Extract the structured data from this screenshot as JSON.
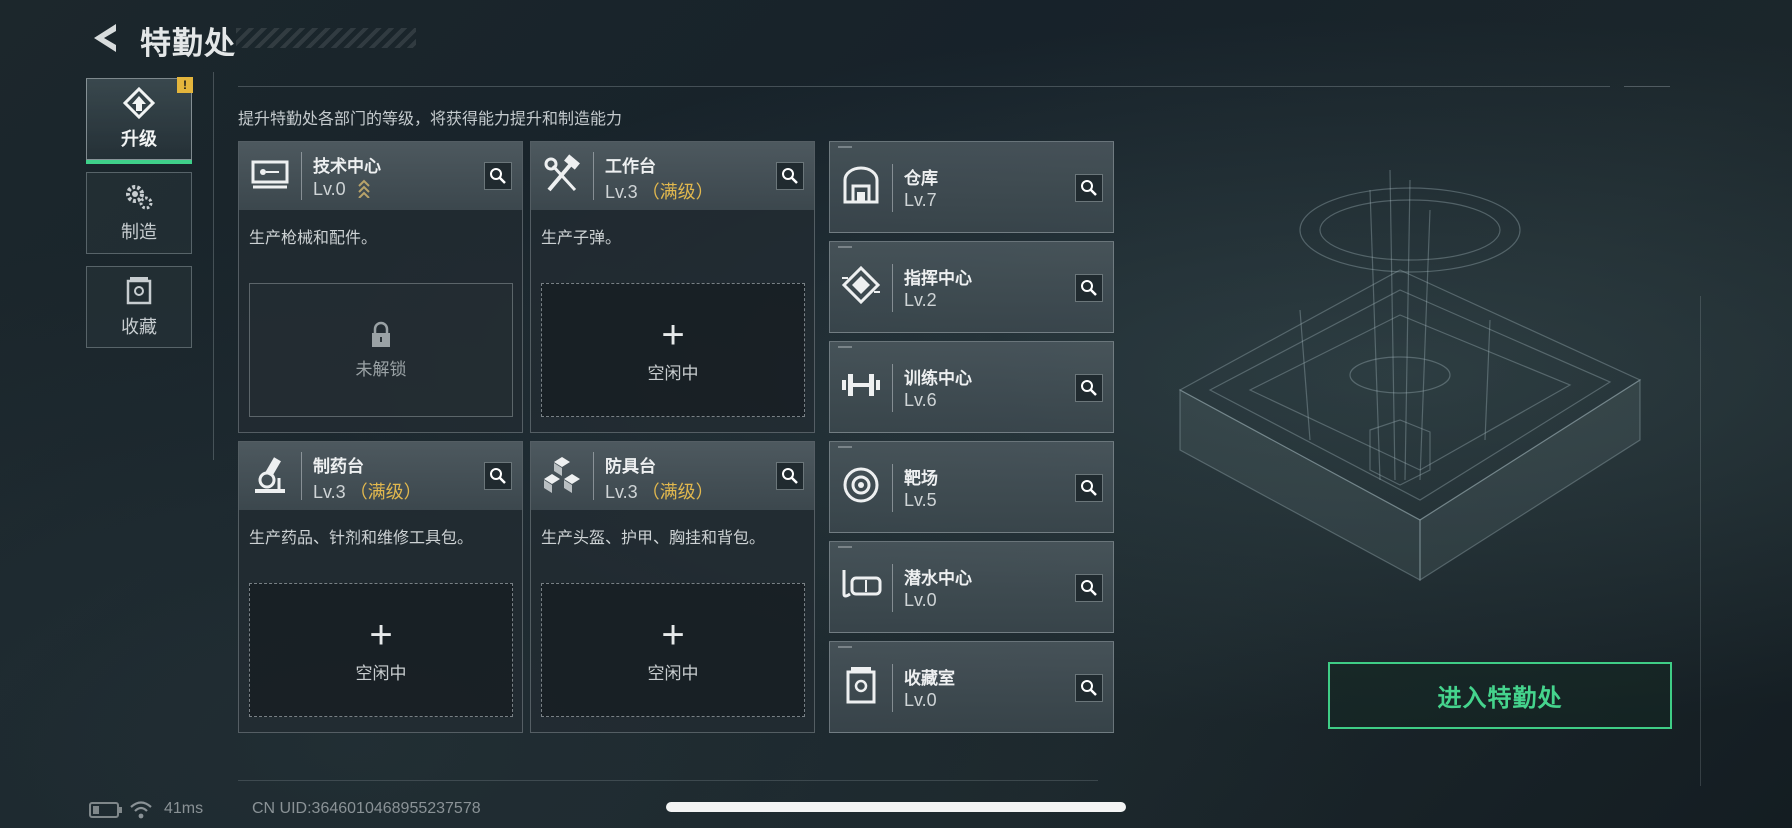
{
  "header": {
    "title": "特勤处"
  },
  "tabs": [
    {
      "label": "升级",
      "active": true,
      "badge": "!",
      "icon": "upgrade-icon"
    },
    {
      "label": "制造",
      "active": false,
      "icon": "gears-icon"
    },
    {
      "label": "收藏",
      "active": false,
      "icon": "collection-icon"
    }
  ],
  "subtitle": "提升特勤处各部门的等级，将获得能力提升和制造能力",
  "workbenches": [
    {
      "name": "技术中心",
      "level": "Lv.0",
      "maxed": "",
      "desc": "生产枪械和配件。",
      "slot": "未解锁",
      "locked": true,
      "icon": "tech-center-icon"
    },
    {
      "name": "工作台",
      "level": "Lv.3",
      "maxed": "（满级）",
      "desc": "生产子弹。",
      "slot": "空闲中",
      "locked": false,
      "icon": "workbench-tools-icon"
    },
    {
      "name": "制药台",
      "level": "Lv.3",
      "maxed": "（满级）",
      "desc": "生产药品、针剂和维修工具包。",
      "slot": "空闲中",
      "locked": false,
      "icon": "microscope-icon"
    },
    {
      "name": "防具台",
      "level": "Lv.3",
      "maxed": "（满级）",
      "desc": "生产头盔、护甲、胸挂和背包。",
      "slot": "空闲中",
      "locked": false,
      "icon": "armor-cubes-icon"
    }
  ],
  "facilities": [
    {
      "name": "仓库",
      "level": "Lv.7",
      "icon": "warehouse-icon"
    },
    {
      "name": "指挥中心",
      "level": "Lv.2",
      "icon": "command-chip-icon"
    },
    {
      "name": "训练中心",
      "level": "Lv.6",
      "icon": "dumbbell-icon"
    },
    {
      "name": "靶场",
      "level": "Lv.5",
      "icon": "target-icon"
    },
    {
      "name": "潜水中心",
      "level": "Lv.0",
      "icon": "diving-mask-icon"
    },
    {
      "name": "收藏室",
      "level": "Lv.0",
      "icon": "collection-room-icon"
    }
  ],
  "enter_button": "进入特勤处",
  "status": {
    "ping": "41ms",
    "uid": "CN UID:364601046895523757​8"
  },
  "colors": {
    "accent_green": "#3fcd86",
    "maxed_gold": "#e2b84e",
    "badge_yellow": "#e4b53c"
  }
}
